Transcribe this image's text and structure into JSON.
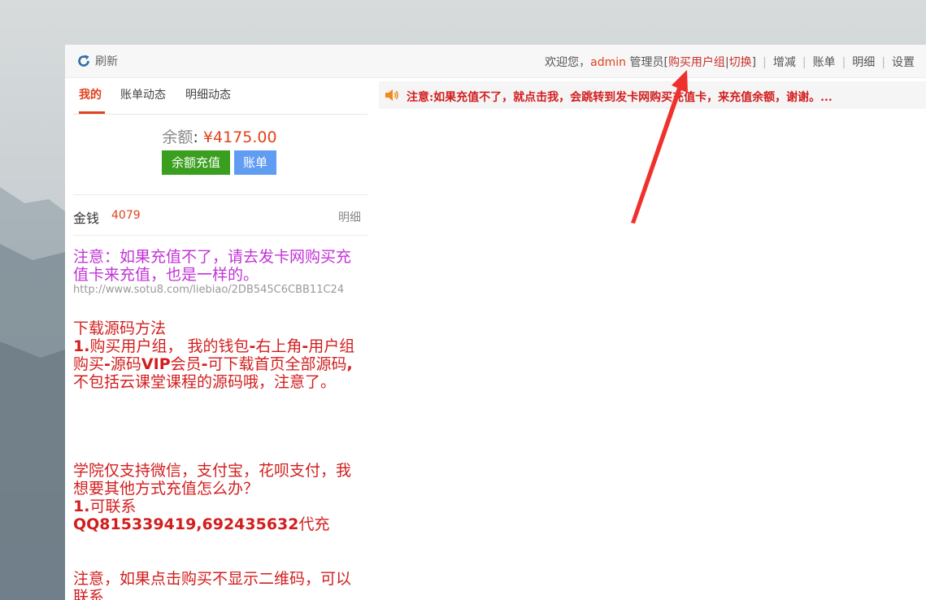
{
  "header": {
    "refresh_label": "刷新",
    "welcome_prefix": "欢迎您，",
    "username": "admin",
    "role_text": " 管理员[",
    "buy_group_label": "购买用户组",
    "pipe": "|",
    "switch_label": "切换",
    "bracket_close": "]",
    "sep": "|",
    "menu": [
      "增减",
      "账单",
      "明细",
      "设置"
    ]
  },
  "tabs": [
    "我的",
    "账单动态",
    "明细动态"
  ],
  "balance": {
    "label": "余额",
    "colon": ":",
    "value": "¥4175.00",
    "recharge_button": "余额充值",
    "bill_button": "账单"
  },
  "money": {
    "label": "金钱",
    "value": "4079",
    "detail_link": "明细"
  },
  "notices": {
    "purple": "注意：如果充值不了，请去发卡网购买充值卡来充值，也是一样的。",
    "url": "http://www.sotu8.com/liebiao/2DB545C6CBB11C24",
    "download_title": "下载源码方法",
    "download_num": "1.",
    "download_p1": "购买用户组，  我的钱包",
    "download_dash1": "-",
    "download_p2": "右上角",
    "download_dash2": "-",
    "download_p3": "用户组购买",
    "download_dash3": "-",
    "download_p4": "源码",
    "download_vip": "VIP",
    "download_p5": "会员",
    "download_dash4": "-",
    "download_p6": "可下载首页全部源码",
    "download_comma": ",",
    "download_p7": "不包括云课堂课程的源码哦，注意了。",
    "payment_p1": "学院仅支持微信，支付宝，花呗支付，我想要其他方式充值怎么办？",
    "payment_num": "1.",
    "payment_p2": "可联系",
    "payment_qq": "QQ815339419,692435632",
    "payment_p3": "代充",
    "qr_note": "注意，如果点击购买不显示二维码，可以联系"
  },
  "notice_bar": {
    "text": "注意:如果充值不了，就点击我，会跳转到发卡网购买充值卡，来充值余额，谢谢。..."
  },
  "colors": {
    "accent": "#e0421b",
    "notice_red": "#d21e1e",
    "notice_purple": "#c233d7",
    "green_button": "#3a9f1e",
    "blue_button": "#5f9cf2",
    "annotation_arrow": "#f0302c"
  }
}
